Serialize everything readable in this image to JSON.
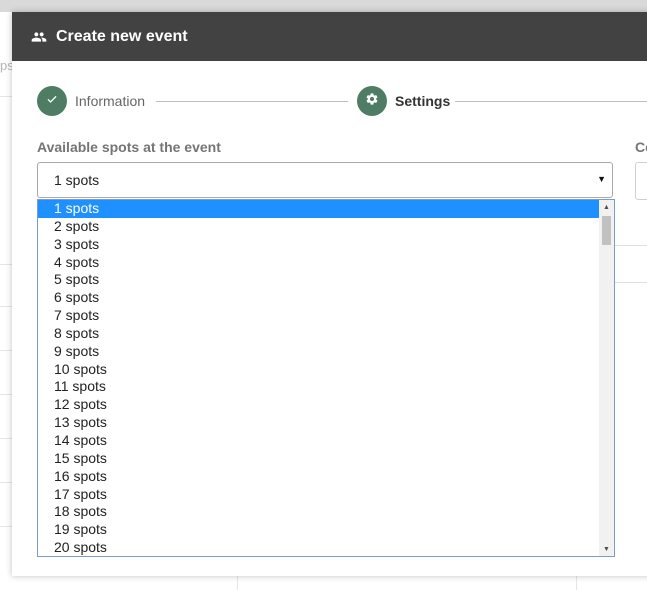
{
  "background": {
    "fragment_text": "ps"
  },
  "modal": {
    "title": "Create new event",
    "title_icon": "group-icon",
    "header_color": "#424242"
  },
  "stepper": {
    "steps": [
      {
        "label": "Information",
        "state": "completed",
        "icon": "check-icon"
      },
      {
        "label": "Settings",
        "state": "active",
        "icon": "gear-icon"
      }
    ],
    "accent_color": "#4f7d63"
  },
  "spots_field": {
    "label": "Available spots at the event",
    "value": "1 spots"
  },
  "second_field": {
    "label": "Co"
  },
  "dropdown": {
    "selected_index": 0,
    "highlight_color": "#1e90ff",
    "options": [
      "1 spots",
      "2 spots",
      "3 spots",
      "4 spots",
      "5 spots",
      "6 spots",
      "7 spots",
      "8 spots",
      "9 spots",
      "10 spots",
      "11 spots",
      "12 spots",
      "13 spots",
      "14 spots",
      "15 spots",
      "16 spots",
      "17 spots",
      "18 spots",
      "19 spots",
      "20 spots"
    ]
  }
}
